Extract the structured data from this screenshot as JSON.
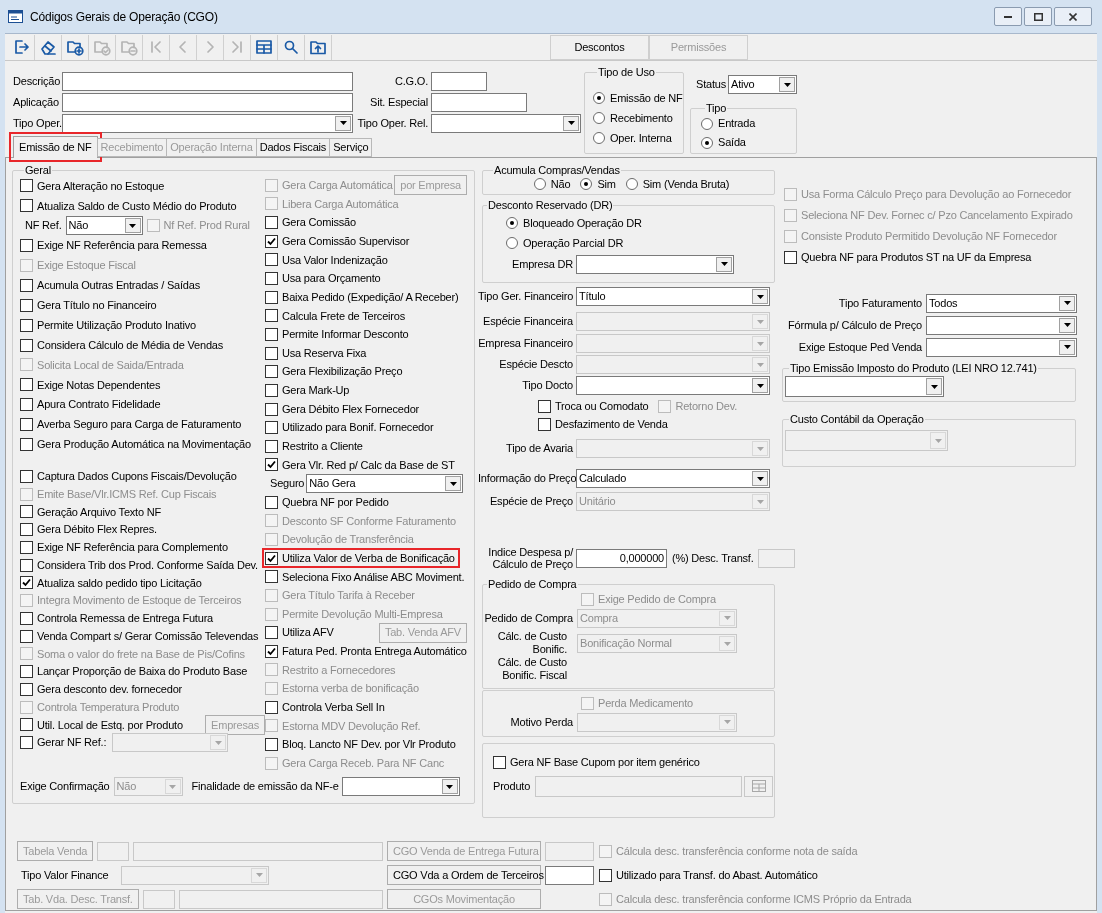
{
  "window": {
    "title": "Códigos Gerais de Operação (CGO)"
  },
  "toolbar": {
    "icon_buttons": [
      {
        "kind": "exit",
        "disabled": false
      },
      {
        "kind": "eraser",
        "disabled": false
      },
      {
        "kind": "folder_add",
        "disabled": false
      },
      {
        "kind": "folder_check",
        "disabled": true
      },
      {
        "kind": "folder_remove",
        "disabled": true
      },
      {
        "kind": "first",
        "disabled": true
      },
      {
        "kind": "prev",
        "disabled": true
      },
      {
        "kind": "next",
        "disabled": true
      },
      {
        "kind": "last",
        "disabled": true
      },
      {
        "kind": "grid",
        "disabled": false
      },
      {
        "kind": "search",
        "disabled": false
      },
      {
        "kind": "upload",
        "disabled": false
      }
    ],
    "buttons": [
      {
        "label": "Descontos",
        "disabled": false
      },
      {
        "label": "Permissões",
        "disabled": true
      }
    ]
  },
  "header": {
    "fields": [
      {
        "kind": "text",
        "label": "Descrição"
      },
      {
        "kind": "text",
        "label": "C.G.O."
      },
      {
        "kind": "text",
        "label": "Aplicação"
      },
      {
        "kind": "text",
        "label": "Sit. Especial"
      },
      {
        "kind": "select",
        "label": "Tipo Oper."
      },
      {
        "kind": "select",
        "label": "Tipo Oper. Rel."
      }
    ],
    "tipo_de_uso": {
      "title": "Tipo de Uso",
      "options": [
        {
          "label": "Emissão de NF",
          "selected": true
        },
        {
          "label": "Recebimento",
          "selected": false
        },
        {
          "label": "Oper. Interna",
          "selected": false
        }
      ]
    },
    "status": {
      "label": "Status",
      "value": "Ativo"
    },
    "tipo": {
      "title": "Tipo",
      "options": [
        {
          "label": "Entrada",
          "selected": false
        },
        {
          "label": "Saída",
          "selected": true
        }
      ]
    }
  },
  "tabs": [
    {
      "label": "Emissão de NF",
      "selected": true,
      "disabled": false,
      "highlighted": true
    },
    {
      "label": "Recebimento",
      "selected": false,
      "disabled": true,
      "highlighted": false
    },
    {
      "label": "Operação Interna",
      "selected": false,
      "disabled": true,
      "highlighted": false
    },
    {
      "label": "Dados Fiscais",
      "selected": false,
      "disabled": false,
      "highlighted": false
    },
    {
      "label": "Serviço",
      "selected": false,
      "disabled": false,
      "highlighted": false
    }
  ],
  "geral": {
    "title": "Geral",
    "columns": [
      [
        {
          "kind": "check",
          "label": "Gera Alteração no Estoque",
          "checked": false,
          "disabled": false
        },
        {
          "kind": "check",
          "label": "Atualiza Saldo de Custo Médio do Produto",
          "checked": false,
          "disabled": false
        },
        {
          "kind": "select",
          "label": "NF Ref.",
          "value": "Não",
          "disabled": false,
          "check": {
            "label": "Nf Ref. Prod Rural",
            "checked": false,
            "disabled": true
          }
        },
        {
          "kind": "check",
          "label": "Exige NF Referência para Remessa",
          "checked": false,
          "disabled": false
        },
        {
          "kind": "check",
          "label": "Exige Estoque Fiscal",
          "checked": false,
          "disabled": true
        },
        {
          "kind": "check",
          "label": "Acumula Outras Entradas / Saídas",
          "checked": false,
          "disabled": false
        },
        {
          "kind": "check",
          "label": "Gera Título no Financeiro",
          "checked": false,
          "disabled": false
        },
        {
          "kind": "check",
          "label": "Permite Utilização Produto Inativo",
          "checked": false,
          "disabled": false
        },
        {
          "kind": "check",
          "label": "Considera Cálculo de Média de Vendas",
          "checked": false,
          "disabled": false
        },
        {
          "kind": "check",
          "label": "Solicita Local de Saida/Entrada",
          "checked": false,
          "disabled": true
        },
        {
          "kind": "check",
          "label": "Exige Notas Dependentes",
          "checked": false,
          "disabled": false
        },
        {
          "kind": "check",
          "label": "Apura Contrato Fidelidade",
          "checked": false,
          "disabled": false
        },
        {
          "kind": "check",
          "label": "Averba Seguro para Carga de Faturamento",
          "checked": false,
          "disabled": false
        },
        {
          "kind": "check",
          "label": "Gera Produção Automática na Movimentação",
          "checked": false,
          "disabled": false
        }
      ],
      [
        {
          "kind": "check",
          "label": "Captura Dados Cupons Fiscais/Devolução",
          "checked": false,
          "disabled": false
        },
        {
          "kind": "check",
          "label": "Emite Base/Vlr.ICMS Ref. Cup Fiscais",
          "checked": false,
          "disabled": true
        },
        {
          "kind": "check",
          "label": "Geração Arquivo Texto NF",
          "checked": false,
          "disabled": false
        },
        {
          "kind": "check",
          "label": "Gera Débito Flex Repres.",
          "checked": false,
          "disabled": false
        },
        {
          "kind": "check",
          "label": "Exige NF Referência para Complemento",
          "checked": false,
          "disabled": false
        },
        {
          "kind": "check",
          "label": "Considera Trib dos Prod. Conforme Saída Dev.",
          "checked": false,
          "disabled": false
        },
        {
          "kind": "check",
          "label": "Atualiza saldo pedido tipo Licitação",
          "checked": true,
          "disabled": false
        },
        {
          "kind": "check",
          "label": "Integra Movimento de Estoque de Terceiros",
          "checked": false,
          "disabled": true
        },
        {
          "kind": "check",
          "label": "Controla Remessa de Entrega Futura",
          "checked": false,
          "disabled": false
        },
        {
          "kind": "check",
          "label": "Venda Compart s/ Gerar Comissão Televendas",
          "checked": false,
          "disabled": false
        },
        {
          "kind": "check",
          "label": "Soma o valor do frete na Base de Pis/Cofins",
          "checked": false,
          "disabled": true
        },
        {
          "kind": "check",
          "label": "Lançar Proporção de Baixa do Produto Base",
          "checked": false,
          "disabled": false
        },
        {
          "kind": "check",
          "label": "Gera desconto dev. fornecedor",
          "checked": false,
          "disabled": false
        },
        {
          "kind": "check",
          "label": "Controla Temperatura Produto",
          "checked": false,
          "disabled": true
        },
        {
          "kind": "check",
          "label": "Util. Local de Estq. por Produto",
          "checked": false,
          "disabled": false,
          "button": {
            "label": "Empresas",
            "disabled": true
          }
        },
        {
          "kind": "check",
          "label": "Gerar NF Ref.:",
          "checked": false,
          "disabled": false,
          "select": {
            "disabled": true
          }
        }
      ],
      [
        {
          "kind": "check",
          "label": "Gera Carga Automática",
          "checked": false,
          "disabled": true,
          "button": {
            "label": "por Empresa",
            "disabled": true
          }
        },
        {
          "kind": "check",
          "label": "Libera Carga Automática",
          "checked": false,
          "disabled": true
        },
        {
          "kind": "check",
          "label": "Gera Comissão",
          "checked": false,
          "disabled": false
        },
        {
          "kind": "check",
          "label": "Gera Comissão Supervisor",
          "checked": true,
          "disabled": false
        },
        {
          "kind": "check",
          "label": "Usa Valor Indenização",
          "checked": false,
          "disabled": false
        },
        {
          "kind": "check",
          "label": "Usa para Orçamento",
          "checked": false,
          "disabled": false
        },
        {
          "kind": "check",
          "label": "Baixa Pedido (Expedição/ A Receber)",
          "checked": false,
          "disabled": false
        },
        {
          "kind": "check",
          "label": "Calcula Frete de Terceiros",
          "checked": false,
          "disabled": false
        },
        {
          "kind": "check",
          "label": "Permite Informar Desconto",
          "checked": false,
          "disabled": false
        },
        {
          "kind": "check",
          "label": "Usa Reserva Fixa",
          "checked": false,
          "disabled": false
        },
        {
          "kind": "check",
          "label": "Gera Flexibilização Preço",
          "checked": false,
          "disabled": false
        },
        {
          "kind": "check",
          "label": "Gera Mark-Up",
          "checked": false,
          "disabled": false
        },
        {
          "kind": "check",
          "label": "Gera Débito Flex Fornecedor",
          "checked": false,
          "disabled": false
        },
        {
          "kind": "check",
          "label": "Utilizado para Bonif. Fornecedor",
          "checked": false,
          "disabled": false
        },
        {
          "kind": "check",
          "label": "Restrito a Cliente",
          "checked": false,
          "disabled": false
        },
        {
          "kind": "check",
          "label": "Gera Vlr. Red p/ Calc da Base de ST",
          "checked": true,
          "disabled": false
        },
        {
          "kind": "select",
          "label": "Seguro",
          "value": "Não Gera",
          "disabled": false
        },
        {
          "kind": "check",
          "label": "Quebra NF por Pedido",
          "checked": false,
          "disabled": false
        },
        {
          "kind": "check",
          "label": "Desconto SF Conforme Faturamento",
          "checked": false,
          "disabled": true
        },
        {
          "kind": "check",
          "label": "Devolução de Transferência",
          "checked": false,
          "disabled": true
        },
        {
          "kind": "check",
          "label": "Utiliza Valor de Verba de Bonificação",
          "checked": true,
          "disabled": false,
          "highlighted": true
        },
        {
          "kind": "check",
          "label": "Seleciona Fixo Análise ABC Moviment.",
          "checked": false,
          "disabled": false
        },
        {
          "kind": "check",
          "label": "Gera Título Tarifa à Receber",
          "checked": false,
          "disabled": true
        },
        {
          "kind": "check",
          "label": "Permite Devolução Multi-Empresa",
          "checked": false,
          "disabled": true
        },
        {
          "kind": "check",
          "label": "Utiliza AFV",
          "checked": false,
          "disabled": false,
          "button": {
            "label": "Tab. Venda AFV",
            "disabled": true
          }
        },
        {
          "kind": "check",
          "label": "Fatura Ped. Pronta Entrega Automático",
          "checked": true,
          "disabled": false
        },
        {
          "kind": "check",
          "label": "Restrito a Fornecedores",
          "checked": false,
          "disabled": true
        },
        {
          "kind": "check",
          "label": "Estorna verba de bonificação",
          "checked": false,
          "disabled": true
        },
        {
          "kind": "check",
          "label": "Controla Verba Sell In",
          "checked": false,
          "disabled": false
        },
        {
          "kind": "check",
          "label": "Estorna MDV Devolução Ref.",
          "checked": false,
          "disabled": true
        },
        {
          "kind": "check",
          "label": "Bloq. Lancto NF Dev. por Vlr Produto",
          "checked": false,
          "disabled": false
        },
        {
          "kind": "check",
          "label": "Gera Carga Receb. Para NF Canc",
          "checked": false,
          "disabled": true
        }
      ]
    ],
    "footer": [
      {
        "label": "Exige Confirmação",
        "value": "Não",
        "disabled": true
      },
      {
        "label": "Finalidade de emissão da NF-e",
        "disabled": false
      }
    ]
  },
  "financeiro": {
    "acumula": {
      "title": "Acumula Compras/Vendas",
      "options": [
        {
          "label": "Não",
          "selected": false
        },
        {
          "label": "Sim",
          "selected": true
        },
        {
          "label": "Sim (Venda Bruta)",
          "selected": false
        }
      ]
    },
    "desconto_reservado": {
      "title": "Desconto Reservado (DR)",
      "options": [
        {
          "label": "Bloqueado Operação DR",
          "selected": true
        },
        {
          "label": "Operação Parcial DR",
          "selected": false
        }
      ],
      "empresa": {
        "label": "Empresa DR",
        "disabled": false
      }
    },
    "rows": [
      {
        "kind": "select",
        "label": "Tipo Ger. Financeiro",
        "value": "Título",
        "disabled": false
      },
      {
        "kind": "select",
        "label": "Espécie Financeira",
        "disabled": true
      },
      {
        "kind": "select",
        "label": "Empresa Financeiro",
        "disabled": true
      },
      {
        "kind": "select",
        "label": "Espécie Descto",
        "disabled": true
      },
      {
        "kind": "select",
        "label": "Tipo Docto",
        "disabled": false
      },
      {
        "kind": "checks",
        "items": [
          {
            "label": "Troca ou Comodato",
            "checked": false,
            "disabled": false
          },
          {
            "label": "Retorno Dev.",
            "checked": false,
            "disabled": true
          }
        ]
      },
      {
        "kind": "checks",
        "items": [
          {
            "label": "Desfazimento de Venda",
            "checked": false,
            "disabled": false
          }
        ]
      },
      {
        "kind": "select",
        "label": "Tipo de Avaria",
        "disabled": true
      },
      {
        "kind": "select",
        "label": "Informação do Preço",
        "value": "Calculado",
        "disabled": false
      },
      {
        "kind": "select",
        "label": "Espécie de Preço",
        "value": "Unitário",
        "disabled": true
      }
    ],
    "indice": {
      "label": "Indice Despesa p/ Cálculo de Preço",
      "value": "0,000000",
      "desc_label": "(%) Desc. Transf.",
      "desc_disabled": true
    },
    "pedido_compra": {
      "title": "Pedido de Compra",
      "exige": {
        "label": "Exige Pedido de Compra",
        "checked": false,
        "disabled": true
      },
      "pedido": {
        "label": "Pedido de Compra",
        "value": "Compra",
        "disabled": true
      },
      "custo": {
        "label": "Cálc. de Custo Bonific.",
        "value": "Bonificação Normal",
        "disabled": true
      },
      "custo_fiscal_label": "Cálc. de Custo Bonific. Fiscal"
    },
    "perda": {
      "check": {
        "label": "Perda Medicamento",
        "checked": false,
        "disabled": true
      },
      "motivo": {
        "label": "Motivo Perda",
        "disabled": true
      }
    },
    "cupom": {
      "check": {
        "label": "Gera NF Base Cupom por item genérico",
        "checked": false,
        "disabled": false
      },
      "produto": {
        "label": "Produto",
        "disabled": true
      }
    }
  },
  "devolucao": {
    "checks": [
      {
        "label": "Usa Forma Cálculo Preço para Devolução ao Fornecedor",
        "checked": false,
        "disabled": true
      },
      {
        "label": "Seleciona NF Dev. Fornec c/ Pzo Cancelamento Expirado",
        "checked": false,
        "disabled": true
      },
      {
        "label": "Consiste Produto Permitido Devolução NF Fornecedor",
        "checked": false,
        "disabled": true
      },
      {
        "label": "Quebra NF para Produtos ST na UF da Empresa",
        "checked": false,
        "disabled": false
      }
    ],
    "selects": [
      {
        "label": "Tipo Faturamento",
        "value": "Todos",
        "disabled": false
      },
      {
        "label": "Fórmula p/ Cálculo de Preço",
        "disabled": false
      },
      {
        "label": "Exige Estoque Ped Venda",
        "disabled": false
      }
    ],
    "tipo_emissao": {
      "title": "Tipo Emissão Imposto do Produto (LEI NRO 12.741)",
      "disabled": false
    },
    "custo_contabil": {
      "title": "Custo Contábil da Operação",
      "disabled": true
    }
  },
  "bottom": {
    "rows": [
      {
        "kind": "table",
        "button": {
          "label": "Tabela Venda",
          "disabled": true
        },
        "code": {
          "disabled": true
        },
        "name": {
          "disabled": true
        },
        "cgo_button": {
          "label": "CGO Venda de Entrega Futura",
          "disabled": true
        },
        "cgo": {
          "disabled": true
        },
        "check": {
          "label": "Cálcula desc. transferência conforme nota de saída",
          "checked": false,
          "disabled": true
        }
      },
      {
        "kind": "select",
        "label": "Tipo Valor Finance",
        "select": {
          "disabled": true
        },
        "cgo_button": {
          "label": "CGO Vda a Ordem de Terceiros",
          "disabled": false
        },
        "cgo": {
          "disabled": false
        },
        "check": {
          "label": "Utilizado para Transf. do Abast. Automático",
          "checked": false,
          "disabled": false
        }
      },
      {
        "kind": "table",
        "button": {
          "label": "Tab. Vda. Desc. Transf.",
          "disabled": true
        },
        "code": {
          "disabled": true
        },
        "name": {
          "disabled": true
        },
        "cgo_button": {
          "label": "CGOs Movimentação",
          "disabled": true
        },
        "check": {
          "label": "Calcula desc. transferência conforme ICMS Próprio da Entrada",
          "checked": false,
          "disabled": true
        }
      }
    ]
  }
}
